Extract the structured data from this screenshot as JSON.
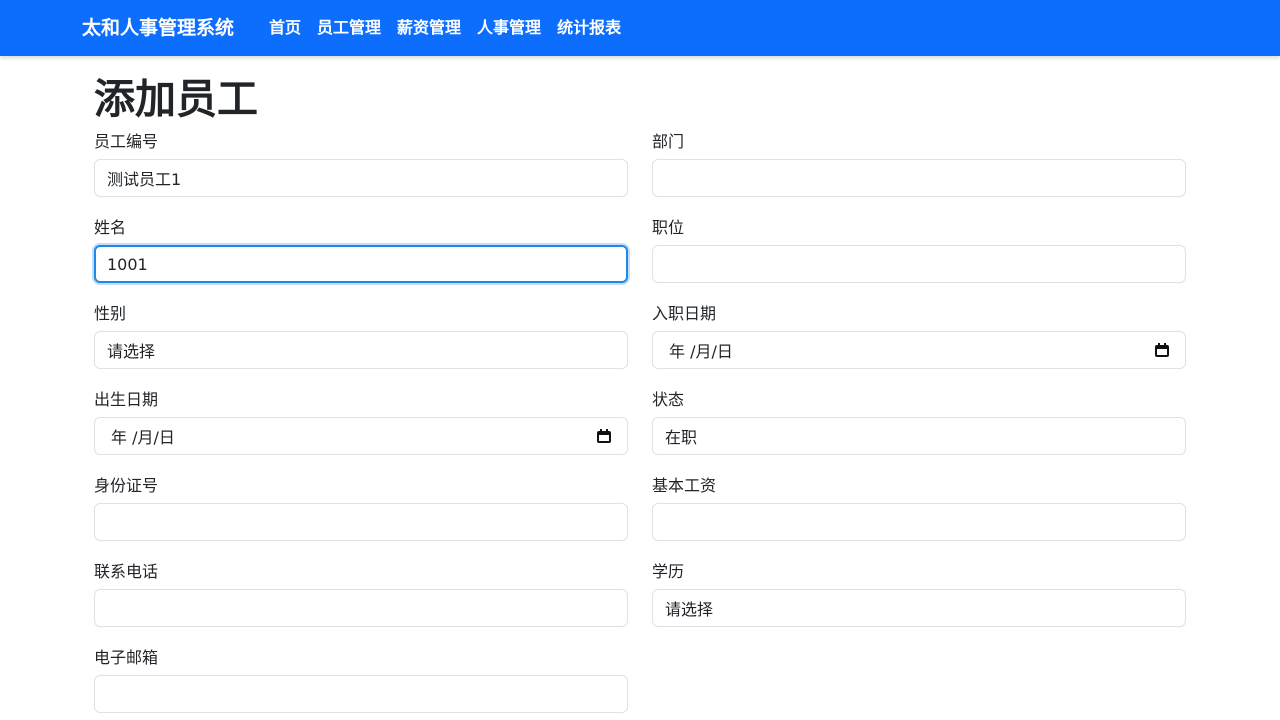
{
  "navbar": {
    "brand": "太和人事管理系统",
    "links": [
      "首页",
      "员工管理",
      "薪资管理",
      "人事管理",
      "统计报表"
    ],
    "color": "#0d6efd"
  },
  "page": {
    "title": "添加员工"
  },
  "form": {
    "employee_id": {
      "label": "员工编号",
      "value": "测试员工1"
    },
    "department": {
      "label": "部门",
      "value": ""
    },
    "name": {
      "label": "姓名",
      "value": "1001"
    },
    "position": {
      "label": "职位",
      "value": ""
    },
    "gender": {
      "label": "性别",
      "value": "请选择"
    },
    "hire_date": {
      "label": "入职日期",
      "value": "年 /月/日"
    },
    "birth_date": {
      "label": "出生日期",
      "value": "年 /月/日"
    },
    "status": {
      "label": "状态",
      "value": "在职"
    },
    "id_number": {
      "label": "身份证号",
      "value": ""
    },
    "base_salary": {
      "label": "基本工资",
      "value": ""
    },
    "phone": {
      "label": "联系电话",
      "value": ""
    },
    "education": {
      "label": "学历",
      "value": "请选择"
    },
    "email": {
      "label": "电子邮箱",
      "value": ""
    }
  },
  "icons": {
    "date_picker": "calendar-icon"
  }
}
